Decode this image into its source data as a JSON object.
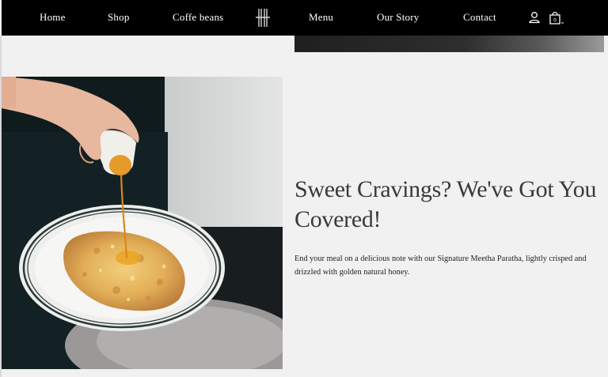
{
  "nav": {
    "items": [
      "Home",
      "Shop",
      "Coffe beans",
      "Menu",
      "Our Story",
      "Contact"
    ],
    "logo_icon": "hh-monogram-logo",
    "account_icon": "user-icon",
    "cart_icon": "shopping-bag-icon"
  },
  "feature": {
    "headline_line1": "Sweet Cravings? We've Got You",
    "headline_line2": "Covered!",
    "body_line1": "End your meal on a delicious note with our Signature Meetha Paratha, lightly crisped and",
    "body_line2": "drizzled with golden natural honey."
  },
  "colors": {
    "nav_bg": "#000000",
    "page_bg": "#f1f1f1",
    "headline": "#3a3a3a"
  }
}
